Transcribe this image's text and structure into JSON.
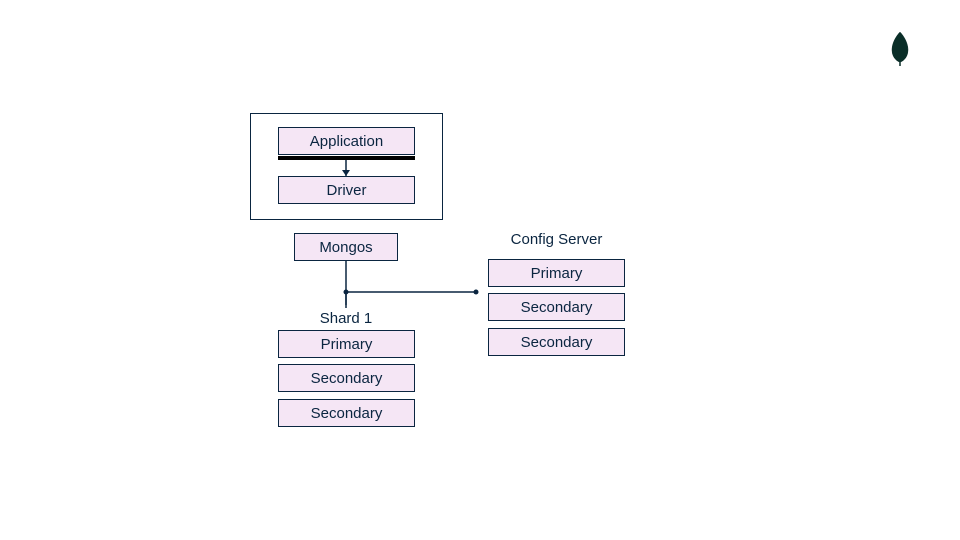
{
  "logo": {
    "name": "mongodb-leaf-icon"
  },
  "client": {
    "application": "Application",
    "driver": "Driver"
  },
  "mongos": "Mongos",
  "shard1": {
    "title": "Shard 1",
    "primary": "Primary",
    "secondary1": "Secondary",
    "secondary2": "Secondary"
  },
  "config": {
    "title": "Config Server",
    "primary": "Primary",
    "secondary1": "Secondary",
    "secondary2": "Secondary"
  },
  "colors": {
    "border": "#0a2540",
    "fill": "#f5e6f5",
    "logo": "#0a2e28"
  }
}
